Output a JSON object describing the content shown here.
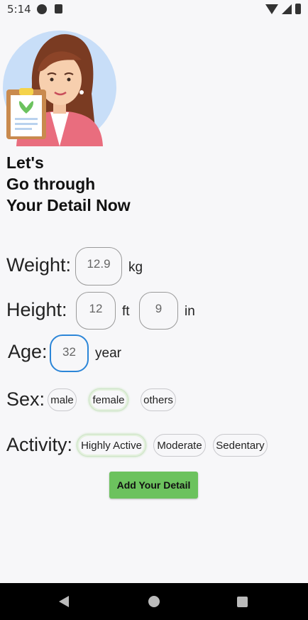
{
  "status_bar": {
    "time": "5:14"
  },
  "headline": {
    "line1": "Let's",
    "line2": "Go through",
    "line3": "Your Detail Now"
  },
  "weight": {
    "label": "Weight:",
    "value": "12.9",
    "unit": "kg"
  },
  "height": {
    "label": "Height:",
    "feet": "12",
    "feet_unit": "ft",
    "inches": "9",
    "inches_unit": "in"
  },
  "age": {
    "label": "Age:",
    "value": "32",
    "unit": "year"
  },
  "sex": {
    "label": "Sex:",
    "options": [
      "male",
      "female",
      "others"
    ],
    "selected": "female"
  },
  "activity": {
    "label": "Activity:",
    "options": [
      "Highly Active",
      "Moderate",
      "Sedentary"
    ],
    "selected": "Highly Active"
  },
  "submit": {
    "label": "Add Your Detail"
  },
  "colors": {
    "accent_green": "#6cc25e",
    "focus_blue": "#2c86d8",
    "avatar_bg": "#c8def8"
  }
}
